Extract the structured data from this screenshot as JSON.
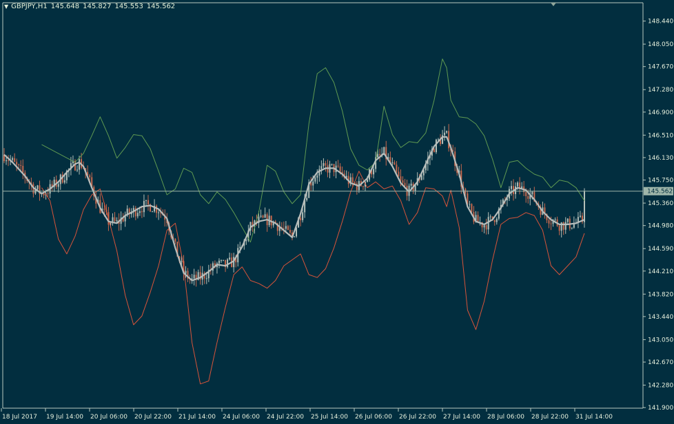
{
  "header": {
    "symbol_timeframe": "GBPJPY,H1",
    "open": "145.648",
    "high": "145.827",
    "low": "145.553",
    "close": "145.562",
    "menu_icon": "triangle-down-icon"
  },
  "colors": {
    "background": "#022e3f",
    "frame": "#b9c9bf",
    "price_text": "#e6efdc",
    "price_line": "#9fb6aa",
    "current_price_bg": "#9fb6aa",
    "current_price_text": "#022e3f",
    "bull_candle": "#b5c0b9",
    "bear_candle": "#c9694e",
    "upper_band": "#5f9a52",
    "lower_band": "#d8543a",
    "middle_line": "#b7bdbb"
  },
  "chart_data": {
    "type": "candlestick",
    "symbol": "GBPJPY",
    "timeframe": "H1",
    "ohlc_last": {
      "open": 145.648,
      "high": 145.827,
      "low": 145.553,
      "close": 145.562
    },
    "current_price_label": "145.562",
    "current_price": 145.562,
    "ylim": [
      141.89,
      148.75
    ],
    "y_ticks": [
      "148.440",
      "148.050",
      "147.670",
      "147.280",
      "146.900",
      "146.510",
      "146.130",
      "145.750",
      "145.360",
      "144.980",
      "144.590",
      "144.210",
      "143.820",
      "143.440",
      "143.050",
      "142.670",
      "142.280",
      "141.900"
    ],
    "x_ticks": [
      "18 Jul 2017",
      "19 Jul 14:00",
      "20 Jul 06:00",
      "20 Jul 22:00",
      "21 Jul 14:00",
      "24 Jul 06:00",
      "24 Jul 22:00",
      "25 Jul 14:00",
      "26 Jul 06:00",
      "26 Jul 22:00",
      "27 Jul 14:00",
      "28 Jul 06:00",
      "28 Jul 22:00",
      "31 Jul 14:00"
    ],
    "middle_line": [
      [
        0,
        146.18
      ],
      [
        4,
        146.05
      ],
      [
        10,
        145.82
      ],
      [
        14,
        145.62
      ],
      [
        18,
        145.52
      ],
      [
        22,
        145.6
      ],
      [
        26,
        145.72
      ],
      [
        30,
        145.88
      ],
      [
        34,
        146.02
      ],
      [
        36,
        146.05
      ],
      [
        38,
        145.98
      ],
      [
        42,
        145.62
      ],
      [
        46,
        145.28
      ],
      [
        50,
        145.05
      ],
      [
        54,
        145.02
      ],
      [
        58,
        145.15
      ],
      [
        62,
        145.22
      ],
      [
        66,
        145.3
      ],
      [
        70,
        145.32
      ],
      [
        74,
        145.26
      ],
      [
        78,
        145.1
      ],
      [
        82,
        144.6
      ],
      [
        86,
        144.18
      ],
      [
        90,
        144.05
      ],
      [
        94,
        144.1
      ],
      [
        98,
        144.2
      ],
      [
        102,
        144.32
      ],
      [
        106,
        144.3
      ],
      [
        110,
        144.38
      ],
      [
        114,
        144.62
      ],
      [
        118,
        144.95
      ],
      [
        122,
        145.05
      ],
      [
        126,
        145.08
      ],
      [
        130,
        145.02
      ],
      [
        134,
        144.9
      ],
      [
        138,
        144.78
      ],
      [
        142,
        145.18
      ],
      [
        146,
        145.68
      ],
      [
        150,
        145.88
      ],
      [
        154,
        145.95
      ],
      [
        158,
        145.95
      ],
      [
        162,
        145.85
      ],
      [
        166,
        145.7
      ],
      [
        170,
        145.65
      ],
      [
        174,
        145.78
      ],
      [
        178,
        146.08
      ],
      [
        182,
        146.2
      ],
      [
        186,
        145.98
      ],
      [
        190,
        145.7
      ],
      [
        194,
        145.55
      ],
      [
        198,
        145.72
      ],
      [
        202,
        146.02
      ],
      [
        206,
        146.32
      ],
      [
        210,
        146.48
      ],
      [
        212,
        146.48
      ],
      [
        214,
        146.3
      ],
      [
        218,
        145.85
      ],
      [
        222,
        145.3
      ],
      [
        226,
        145.05
      ],
      [
        230,
        145.0
      ],
      [
        234,
        145.08
      ],
      [
        238,
        145.28
      ],
      [
        242,
        145.52
      ],
      [
        246,
        145.62
      ],
      [
        250,
        145.58
      ],
      [
        254,
        145.42
      ],
      [
        258,
        145.22
      ],
      [
        262,
        145.08
      ],
      [
        266,
        145.0
      ],
      [
        270,
        145.0
      ],
      [
        274,
        145.02
      ],
      [
        278,
        145.08
      ]
    ],
    "upper_band": [
      [
        18,
        146.35
      ],
      [
        26,
        146.2
      ],
      [
        34,
        146.05
      ],
      [
        38,
        146.2
      ],
      [
        42,
        146.5
      ],
      [
        46,
        146.82
      ],
      [
        50,
        146.5
      ],
      [
        54,
        146.12
      ],
      [
        58,
        146.3
      ],
      [
        62,
        146.52
      ],
      [
        66,
        146.5
      ],
      [
        70,
        146.28
      ],
      [
        74,
        145.9
      ],
      [
        78,
        145.5
      ],
      [
        82,
        145.6
      ],
      [
        86,
        145.95
      ],
      [
        90,
        145.88
      ],
      [
        94,
        145.5
      ],
      [
        98,
        145.35
      ],
      [
        102,
        145.55
      ],
      [
        106,
        145.42
      ],
      [
        110,
        145.2
      ],
      [
        114,
        144.95
      ],
      [
        118,
        144.7
      ],
      [
        122,
        145.2
      ],
      [
        126,
        146.0
      ],
      [
        130,
        145.9
      ],
      [
        134,
        145.55
      ],
      [
        138,
        145.35
      ],
      [
        142,
        145.5
      ],
      [
        146,
        146.7
      ],
      [
        150,
        147.55
      ],
      [
        154,
        147.65
      ],
      [
        158,
        147.4
      ],
      [
        162,
        146.92
      ],
      [
        166,
        146.28
      ],
      [
        170,
        146.0
      ],
      [
        174,
        145.92
      ],
      [
        178,
        146.05
      ],
      [
        182,
        147.0
      ],
      [
        186,
        146.52
      ],
      [
        190,
        146.3
      ],
      [
        194,
        146.4
      ],
      [
        198,
        146.38
      ],
      [
        202,
        146.55
      ],
      [
        206,
        147.1
      ],
      [
        210,
        147.8
      ],
      [
        212,
        147.65
      ],
      [
        214,
        147.1
      ],
      [
        218,
        146.82
      ],
      [
        222,
        146.8
      ],
      [
        226,
        146.7
      ],
      [
        230,
        146.5
      ],
      [
        234,
        146.1
      ],
      [
        238,
        145.62
      ],
      [
        242,
        146.05
      ],
      [
        246,
        146.08
      ],
      [
        250,
        145.95
      ],
      [
        254,
        145.85
      ],
      [
        258,
        145.8
      ],
      [
        262,
        145.62
      ],
      [
        266,
        145.75
      ],
      [
        270,
        145.72
      ],
      [
        274,
        145.62
      ],
      [
        278,
        145.4
      ]
    ],
    "lower_band": [
      [
        18,
        145.62
      ],
      [
        22,
        145.4
      ],
      [
        26,
        144.75
      ],
      [
        30,
        144.5
      ],
      [
        34,
        144.8
      ],
      [
        38,
        145.25
      ],
      [
        42,
        145.5
      ],
      [
        46,
        145.6
      ],
      [
        50,
        145.1
      ],
      [
        54,
        144.55
      ],
      [
        58,
        143.8
      ],
      [
        62,
        143.3
      ],
      [
        66,
        143.45
      ],
      [
        70,
        143.85
      ],
      [
        74,
        144.3
      ],
      [
        78,
        144.9
      ],
      [
        82,
        145.02
      ],
      [
        86,
        144.3
      ],
      [
        90,
        143.0
      ],
      [
        94,
        142.3
      ],
      [
        98,
        142.35
      ],
      [
        102,
        143.0
      ],
      [
        106,
        143.6
      ],
      [
        110,
        144.15
      ],
      [
        114,
        144.28
      ],
      [
        118,
        144.05
      ],
      [
        122,
        144.0
      ],
      [
        126,
        143.92
      ],
      [
        130,
        144.05
      ],
      [
        134,
        144.3
      ],
      [
        138,
        144.4
      ],
      [
        142,
        144.5
      ],
      [
        146,
        144.15
      ],
      [
        150,
        144.1
      ],
      [
        154,
        144.25
      ],
      [
        158,
        144.6
      ],
      [
        162,
        145.05
      ],
      [
        166,
        145.55
      ],
      [
        170,
        145.9
      ],
      [
        174,
        145.62
      ],
      [
        178,
        145.72
      ],
      [
        182,
        145.6
      ],
      [
        186,
        145.65
      ],
      [
        190,
        145.4
      ],
      [
        194,
        145.0
      ],
      [
        198,
        145.2
      ],
      [
        202,
        145.62
      ],
      [
        206,
        145.6
      ],
      [
        210,
        145.48
      ],
      [
        212,
        145.3
      ],
      [
        214,
        145.58
      ],
      [
        218,
        144.95
      ],
      [
        222,
        143.55
      ],
      [
        226,
        143.22
      ],
      [
        230,
        143.7
      ],
      [
        234,
        144.4
      ],
      [
        238,
        145.0
      ],
      [
        242,
        145.1
      ],
      [
        246,
        145.12
      ],
      [
        250,
        145.2
      ],
      [
        254,
        145.15
      ],
      [
        258,
        144.9
      ],
      [
        262,
        144.3
      ],
      [
        266,
        144.15
      ],
      [
        270,
        144.3
      ],
      [
        274,
        144.45
      ],
      [
        278,
        144.85
      ]
    ]
  }
}
